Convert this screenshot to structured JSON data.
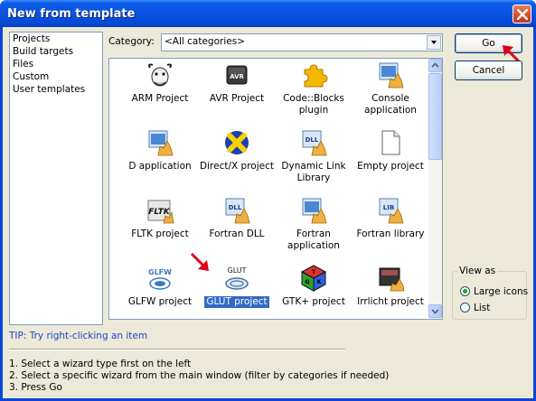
{
  "window": {
    "title": "New from template"
  },
  "sidebar": {
    "items": [
      "Projects",
      "Build targets",
      "Files",
      "Custom",
      "User templates"
    ]
  },
  "category": {
    "label": "Category:",
    "value": "<All categories>"
  },
  "templates": [
    {
      "label": "ARM Project",
      "icon": "gnu-icon"
    },
    {
      "label": "AVR Project",
      "icon": "avr-chip-icon"
    },
    {
      "label": "Code::Blocks plugin",
      "icon": "puzzle-plugin-icon"
    },
    {
      "label": "Console application",
      "icon": "console-app-icon"
    },
    {
      "label": "D application",
      "icon": "d-app-icon"
    },
    {
      "label": "Direct/X project",
      "icon": "directx-icon"
    },
    {
      "label": "Dynamic Link Library",
      "icon": "dll-icon"
    },
    {
      "label": "Empty project",
      "icon": "empty-doc-icon"
    },
    {
      "label": "FLTK project",
      "icon": "fltk-icon"
    },
    {
      "label": "Fortran DLL",
      "icon": "fortran-dll-icon"
    },
    {
      "label": "Fortran application",
      "icon": "fortran-app-icon"
    },
    {
      "label": "Fortran library",
      "icon": "fortran-lib-icon"
    },
    {
      "label": "GLFW project",
      "icon": "glfw-icon"
    },
    {
      "label": "GLUT project",
      "icon": "glut-icon",
      "selected": true
    },
    {
      "label": "GTK+ project",
      "icon": "gtk-icon"
    },
    {
      "label": "Irrlicht project",
      "icon": "irrlicht-icon"
    }
  ],
  "buttons": {
    "go": "Go",
    "cancel": "Cancel"
  },
  "view_as": {
    "label": "View as",
    "large": "Large icons",
    "list": "List",
    "selected": "Large icons"
  },
  "tip": "TIP: Try right-clicking an item",
  "instructions": [
    "1. Select a wizard type first on the left",
    "2. Select a specific wizard from the main window (filter by categories if needed)",
    "3. Press Go"
  ],
  "colors": {
    "titlebar": "#0a53df",
    "selection": "#316ac5",
    "tip": "#1f47c8",
    "annotation_arrow": "#e0001a"
  }
}
